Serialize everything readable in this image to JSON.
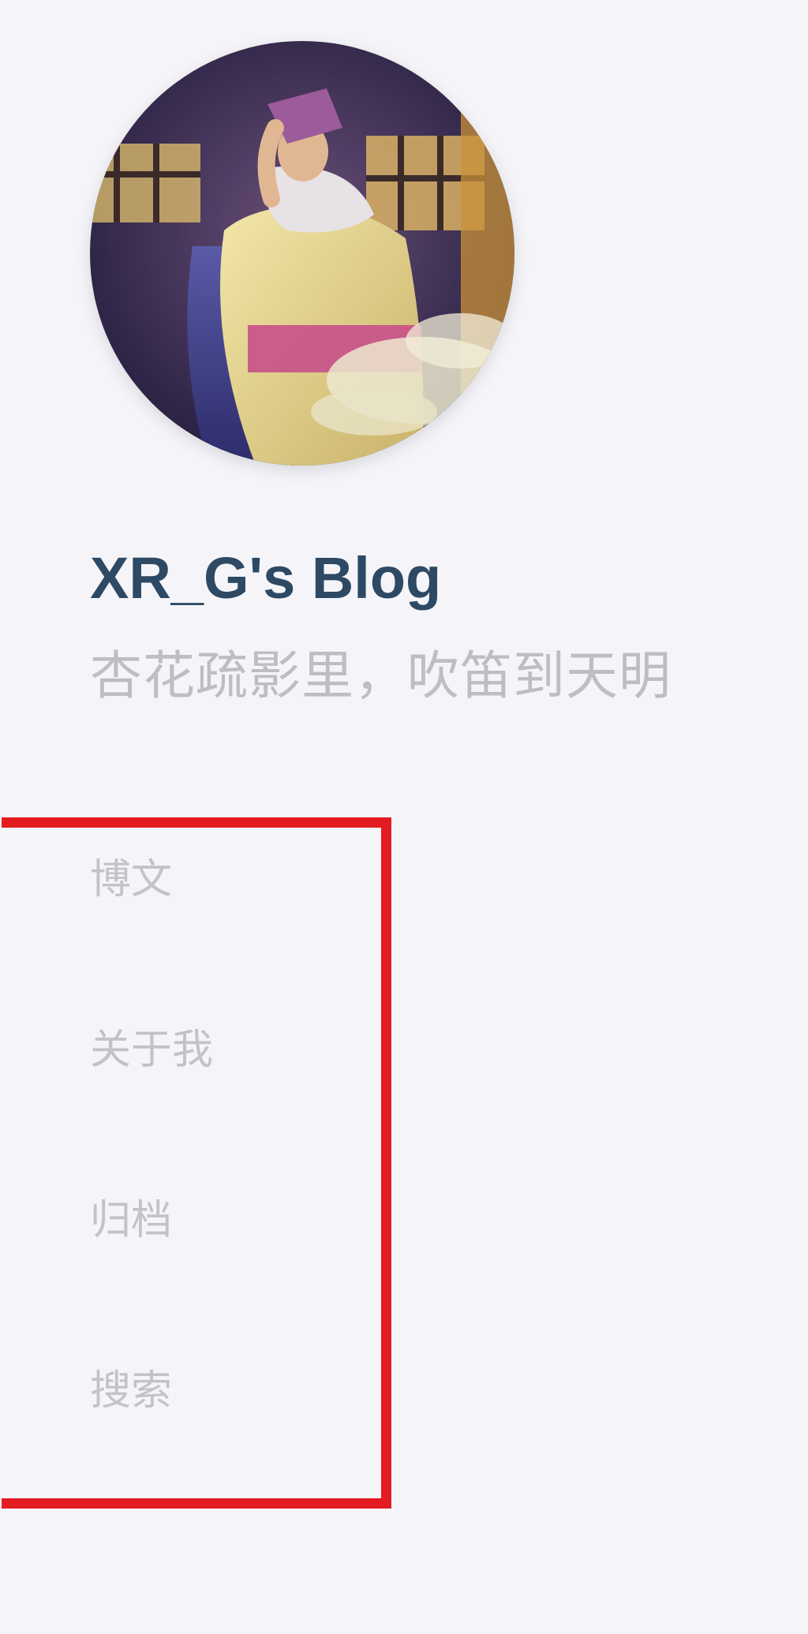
{
  "site": {
    "title": "XR_G's Blog",
    "subtitle": "杏花疏影里，吹笛到天明"
  },
  "avatar": {
    "icon": "avatar-portrait"
  },
  "nav": {
    "items": [
      {
        "label": "博文"
      },
      {
        "label": "关于我"
      },
      {
        "label": "归档"
      },
      {
        "label": "搜索"
      }
    ]
  },
  "colors": {
    "background": "#f5f5f9",
    "title": "#2e4963",
    "subtitle": "#bdbdc3",
    "nav_text": "#c2c2c8",
    "highlight_box": "#e31c22"
  }
}
